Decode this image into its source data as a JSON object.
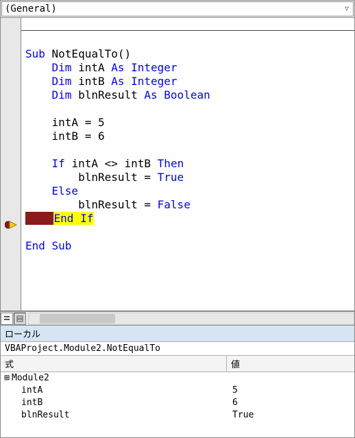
{
  "dropdown": {
    "object": "(General)"
  },
  "code": {
    "sub_kw": "Sub ",
    "sub_name": "NotEqualTo()",
    "dim_kw": "Dim ",
    "as_int": "As Integer",
    "as_bool": "As Boolean",
    "var_a": "intA ",
    "var_b": "intB ",
    "var_r": "blnResult ",
    "assign_a": "    intA = 5",
    "assign_b": "    intB = 6",
    "if_kw": "If ",
    "if_cond": "intA <> intB ",
    "then_kw": "Then",
    "res_true_pre": "        blnResult = ",
    "true_kw": "True",
    "else_kw": "Else",
    "res_false_pre": "        blnResult = ",
    "false_kw": "False",
    "endif_brk": "    ",
    "endif_cur": "End If",
    "endsub_kw": "End Sub"
  },
  "locals": {
    "title": "ローカル",
    "context": "VBAProject.Module2.NotEqualTo",
    "header_expr": "式",
    "header_val": "値",
    "rows": [
      {
        "name": "Module2",
        "value": "",
        "expandable": true
      },
      {
        "name": "intA",
        "value": "5",
        "expandable": false
      },
      {
        "name": "intB",
        "value": "6",
        "expandable": false
      },
      {
        "name": "blnResult",
        "value": "True",
        "expandable": false
      }
    ]
  }
}
